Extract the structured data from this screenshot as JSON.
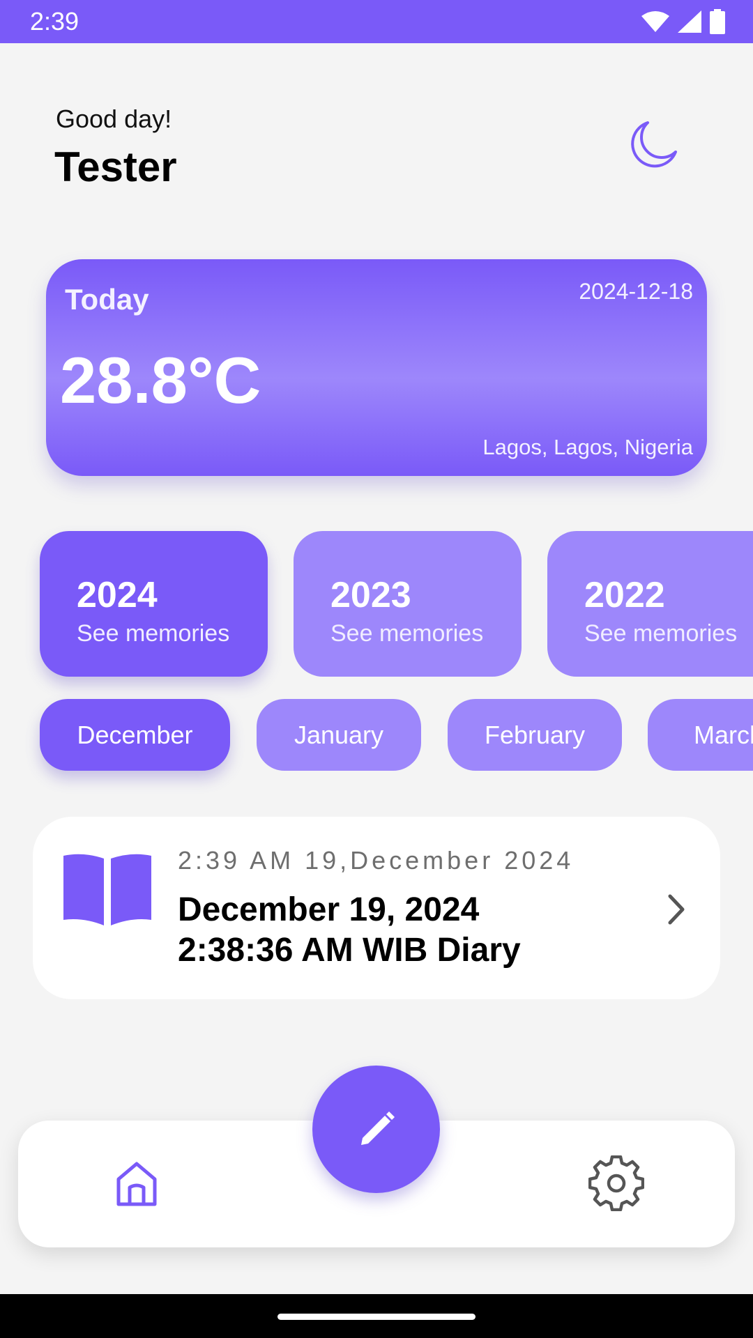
{
  "status_bar": {
    "time": "2:39",
    "icons": [
      "wifi-icon",
      "signal-icon",
      "battery-icon"
    ]
  },
  "header": {
    "greeting": "Good day!",
    "user_name": "Tester",
    "theme_icon": "moon-icon"
  },
  "weather": {
    "label": "Today",
    "date": "2024-12-18",
    "temperature": "28.8°C",
    "location": "Lagos, Lagos, Nigeria"
  },
  "years": [
    {
      "year": "2024",
      "subtitle": "See memories",
      "active": true
    },
    {
      "year": "2023",
      "subtitle": "See memories",
      "active": false
    },
    {
      "year": "2022",
      "subtitle": "See memories",
      "active": false
    }
  ],
  "months": [
    {
      "label": "December",
      "active": true
    },
    {
      "label": "January",
      "active": false
    },
    {
      "label": "February",
      "active": false
    },
    {
      "label": "March",
      "active": false
    }
  ],
  "diary": {
    "icon": "open-book-icon",
    "time": "2:39 AM 19,December 2024",
    "title": "December 19, 2024 2:38:36 AM WIB Diary"
  },
  "bottom_nav": {
    "home_icon": "home-icon",
    "fab_icon": "pencil-icon",
    "settings_icon": "gear-icon"
  },
  "colors": {
    "accent": "#7a5af8",
    "accent_light": "#9d87fb",
    "background": "#f4f4f4"
  }
}
